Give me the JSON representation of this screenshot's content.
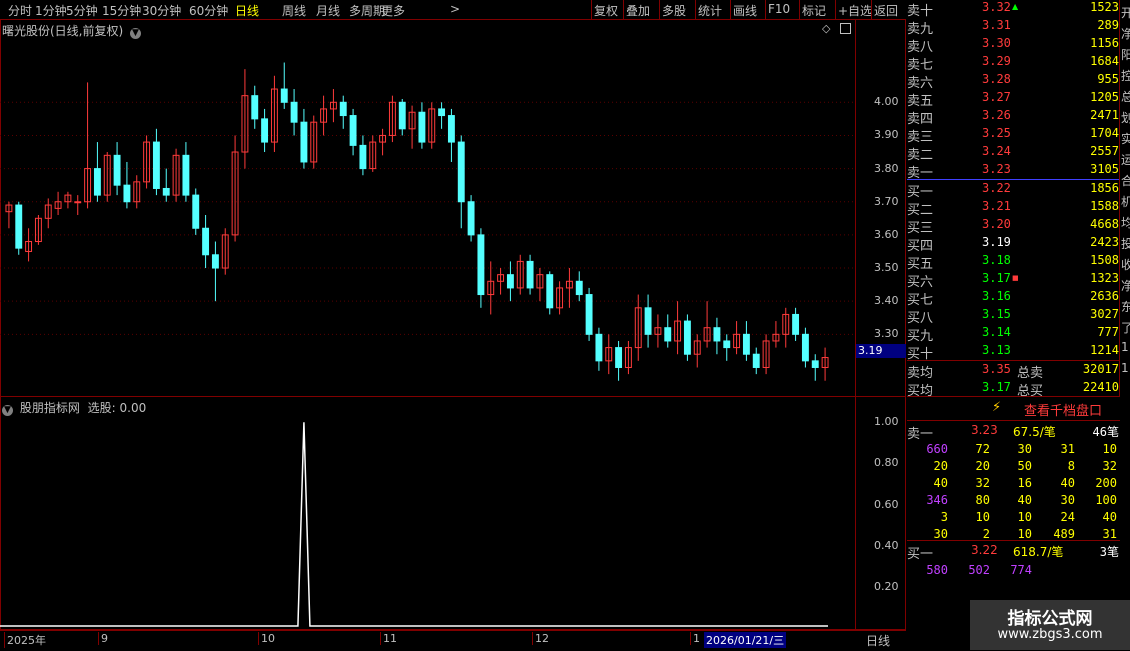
{
  "toolbar": {
    "periods": [
      "分时",
      "1分钟",
      "5分钟",
      "15分钟",
      "30分钟",
      "60分钟",
      "日线",
      "周线",
      "月线",
      "多周期",
      "更多"
    ],
    "active_period": "日线",
    "more_arrow": ">",
    "right_buttons": [
      "复权",
      "叠加",
      "多股",
      "统计",
      "画线",
      "F10",
      "标记",
      "+自选",
      "返回"
    ]
  },
  "main_chart": {
    "title": "曙光股份(日线,前复权)",
    "y_ticks": [
      "4.00",
      "3.90",
      "3.80",
      "3.70",
      "3.60",
      "3.50",
      "3.40",
      "3.30"
    ],
    "current_price_label": "3.19"
  },
  "indicator": {
    "title": "股朋指标网",
    "value_label": "选股: 0.00",
    "y_ticks": [
      "1.00",
      "0.80",
      "0.60",
      "0.40",
      "0.20"
    ]
  },
  "time_axis": {
    "labels": [
      "2025年",
      "9",
      "10",
      "11",
      "12",
      "1"
    ],
    "cursor_date": "2026/01/21/三",
    "period_label": "日线"
  },
  "order_book": {
    "asks": [
      {
        "label": "卖十",
        "price": "3.32",
        "vol": "1523",
        "marker": "▲"
      },
      {
        "label": "卖九",
        "price": "3.31",
        "vol": "289"
      },
      {
        "label": "卖八",
        "price": "3.30",
        "vol": "1156"
      },
      {
        "label": "卖七",
        "price": "3.29",
        "vol": "1684"
      },
      {
        "label": "卖六",
        "price": "3.28",
        "vol": "955"
      },
      {
        "label": "卖五",
        "price": "3.27",
        "vol": "1205"
      },
      {
        "label": "卖四",
        "price": "3.26",
        "vol": "2471"
      },
      {
        "label": "卖三",
        "price": "3.25",
        "vol": "1704"
      },
      {
        "label": "卖二",
        "price": "3.24",
        "vol": "2557"
      },
      {
        "label": "卖一",
        "price": "3.23",
        "vol": "3105"
      }
    ],
    "bids": [
      {
        "label": "买一",
        "price": "3.22",
        "vol": "1856"
      },
      {
        "label": "买二",
        "price": "3.21",
        "vol": "1588"
      },
      {
        "label": "买三",
        "price": "3.20",
        "vol": "4668"
      },
      {
        "label": "买四",
        "price": "3.19",
        "vol": "2423"
      },
      {
        "label": "买五",
        "price": "3.18",
        "vol": "1508"
      },
      {
        "label": "买六",
        "price": "3.17",
        "vol": "1323",
        "marker": "■"
      },
      {
        "label": "买七",
        "price": "3.16",
        "vol": "2636"
      },
      {
        "label": "买八",
        "price": "3.15",
        "vol": "3027"
      },
      {
        "label": "买九",
        "price": "3.14",
        "vol": "777"
      },
      {
        "label": "买十",
        "price": "3.13",
        "vol": "1214"
      }
    ],
    "ask_avg": {
      "label": "卖均",
      "price": "3.35",
      "total_label": "总卖",
      "total": "32017"
    },
    "bid_avg": {
      "label": "买均",
      "price": "3.17",
      "total_label": "总买",
      "total": "22410"
    }
  },
  "level2": {
    "lightning_icon": "⚡",
    "button": "查看千档盘口",
    "sell1": {
      "label": "卖一",
      "price": "3.23",
      "per": "67.5/笔",
      "count": "46笔"
    },
    "sell_grid": [
      [
        "660",
        "72",
        "30",
        "31",
        "10"
      ],
      [
        "20",
        "20",
        "50",
        "8",
        "32"
      ],
      [
        "40",
        "32",
        "16",
        "40",
        "200"
      ],
      [
        "346",
        "80",
        "40",
        "30",
        "100"
      ],
      [
        "3",
        "10",
        "10",
        "24",
        "40"
      ],
      [
        "30",
        "2",
        "10",
        "489",
        "31"
      ]
    ],
    "buy1": {
      "label": "买一",
      "price": "3.22",
      "per": "618.7/笔",
      "count": "3笔"
    },
    "buy_grid": [
      [
        "580",
        "502",
        "774"
      ]
    ]
  },
  "side_strip_chars": [
    "开",
    "净",
    "阳",
    "控",
    "总",
    "划",
    "实",
    "运",
    "合",
    "机",
    "均",
    "投",
    "收",
    "净",
    "东",
    "了",
    "1",
    "1"
  ],
  "watermark": {
    "title": "指标公式网",
    "url": "www.zbgs3.com"
  },
  "colors": {
    "up": "#ff3b3b",
    "down": "#54ffff",
    "border": "#800000",
    "bg": "#000000"
  },
  "chart_data": {
    "type": "candlestick",
    "note_source": "read from figure",
    "y_range": [
      3.12,
      4.2
    ],
    "indicator_range": [
      0,
      1.05
    ],
    "ohlc": [
      [
        3.67,
        3.7,
        3.62,
        3.69
      ],
      [
        3.69,
        3.7,
        3.54,
        3.56
      ],
      [
        3.55,
        3.62,
        3.52,
        3.58
      ],
      [
        3.58,
        3.66,
        3.57,
        3.65
      ],
      [
        3.65,
        3.71,
        3.62,
        3.69
      ],
      [
        3.68,
        3.73,
        3.66,
        3.7
      ],
      [
        3.7,
        3.73,
        3.68,
        3.72
      ],
      [
        3.7,
        3.72,
        3.66,
        3.7
      ],
      [
        3.7,
        4.06,
        3.68,
        3.8
      ],
      [
        3.8,
        3.88,
        3.7,
        3.72
      ],
      [
        3.72,
        3.85,
        3.7,
        3.84
      ],
      [
        3.84,
        3.88,
        3.72,
        3.75
      ],
      [
        3.75,
        3.82,
        3.68,
        3.7
      ],
      [
        3.7,
        3.78,
        3.68,
        3.76
      ],
      [
        3.76,
        3.9,
        3.74,
        3.88
      ],
      [
        3.88,
        3.92,
        3.72,
        3.74
      ],
      [
        3.74,
        3.8,
        3.7,
        3.72
      ],
      [
        3.72,
        3.86,
        3.7,
        3.84
      ],
      [
        3.84,
        3.88,
        3.7,
        3.72
      ],
      [
        3.72,
        3.74,
        3.6,
        3.62
      ],
      [
        3.62,
        3.66,
        3.5,
        3.54
      ],
      [
        3.54,
        3.58,
        3.4,
        3.5
      ],
      [
        3.5,
        3.62,
        3.48,
        3.6
      ],
      [
        3.6,
        3.9,
        3.58,
        3.85
      ],
      [
        3.85,
        4.1,
        3.8,
        4.02
      ],
      [
        4.02,
        4.05,
        3.92,
        3.95
      ],
      [
        3.95,
        3.98,
        3.85,
        3.88
      ],
      [
        3.88,
        4.08,
        3.85,
        4.04
      ],
      [
        4.04,
        4.12,
        3.98,
        4.0
      ],
      [
        4.0,
        4.04,
        3.9,
        3.94
      ],
      [
        3.94,
        3.98,
        3.8,
        3.82
      ],
      [
        3.82,
        3.96,
        3.8,
        3.94
      ],
      [
        3.94,
        4.02,
        3.9,
        3.98
      ],
      [
        3.98,
        4.04,
        3.94,
        4.0
      ],
      [
        4.0,
        4.02,
        3.92,
        3.96
      ],
      [
        3.96,
        3.98,
        3.84,
        3.87
      ],
      [
        3.87,
        3.9,
        3.78,
        3.8
      ],
      [
        3.8,
        3.9,
        3.79,
        3.88
      ],
      [
        3.88,
        3.92,
        3.84,
        3.9
      ],
      [
        3.9,
        4.02,
        3.88,
        4.0
      ],
      [
        4.0,
        4.01,
        3.9,
        3.92
      ],
      [
        3.92,
        3.99,
        3.86,
        3.97
      ],
      [
        3.97,
        4.0,
        3.86,
        3.88
      ],
      [
        3.88,
        4.0,
        3.86,
        3.98
      ],
      [
        3.98,
        4.0,
        3.92,
        3.96
      ],
      [
        3.96,
        3.98,
        3.82,
        3.88
      ],
      [
        3.88,
        3.9,
        3.62,
        3.7
      ],
      [
        3.7,
        3.72,
        3.58,
        3.6
      ],
      [
        3.6,
        3.62,
        3.38,
        3.42
      ],
      [
        3.42,
        3.52,
        3.36,
        3.46
      ],
      [
        3.46,
        3.5,
        3.42,
        3.48
      ],
      [
        3.48,
        3.52,
        3.4,
        3.44
      ],
      [
        3.44,
        3.54,
        3.42,
        3.52
      ],
      [
        3.52,
        3.54,
        3.42,
        3.44
      ],
      [
        3.44,
        3.5,
        3.4,
        3.48
      ],
      [
        3.48,
        3.49,
        3.36,
        3.38
      ],
      [
        3.38,
        3.46,
        3.36,
        3.44
      ],
      [
        3.44,
        3.5,
        3.38,
        3.46
      ],
      [
        3.46,
        3.49,
        3.4,
        3.42
      ],
      [
        3.42,
        3.44,
        3.28,
        3.3
      ],
      [
        3.3,
        3.32,
        3.19,
        3.22
      ],
      [
        3.22,
        3.3,
        3.18,
        3.26
      ],
      [
        3.26,
        3.28,
        3.16,
        3.2
      ],
      [
        3.2,
        3.28,
        3.18,
        3.26
      ],
      [
        3.26,
        3.42,
        3.22,
        3.38
      ],
      [
        3.38,
        3.42,
        3.26,
        3.3
      ],
      [
        3.3,
        3.36,
        3.26,
        3.32
      ],
      [
        3.32,
        3.36,
        3.26,
        3.28
      ],
      [
        3.28,
        3.4,
        3.24,
        3.34
      ],
      [
        3.34,
        3.36,
        3.22,
        3.24
      ],
      [
        3.24,
        3.3,
        3.2,
        3.28
      ],
      [
        3.28,
        3.4,
        3.26,
        3.32
      ],
      [
        3.32,
        3.35,
        3.24,
        3.28
      ],
      [
        3.28,
        3.3,
        3.22,
        3.26
      ],
      [
        3.26,
        3.34,
        3.24,
        3.3
      ],
      [
        3.3,
        3.34,
        3.22,
        3.24
      ],
      [
        3.24,
        3.26,
        3.18,
        3.2
      ],
      [
        3.2,
        3.3,
        3.18,
        3.28
      ],
      [
        3.28,
        3.34,
        3.26,
        3.3
      ],
      [
        3.3,
        3.38,
        3.26,
        3.36
      ],
      [
        3.36,
        3.38,
        3.28,
        3.3
      ],
      [
        3.3,
        3.32,
        3.2,
        3.22
      ],
      [
        3.22,
        3.24,
        3.16,
        3.2
      ],
      [
        3.2,
        3.26,
        3.16,
        3.23
      ]
    ],
    "indicator_signal_index": 30,
    "indicator_signal_value": 1.0
  }
}
